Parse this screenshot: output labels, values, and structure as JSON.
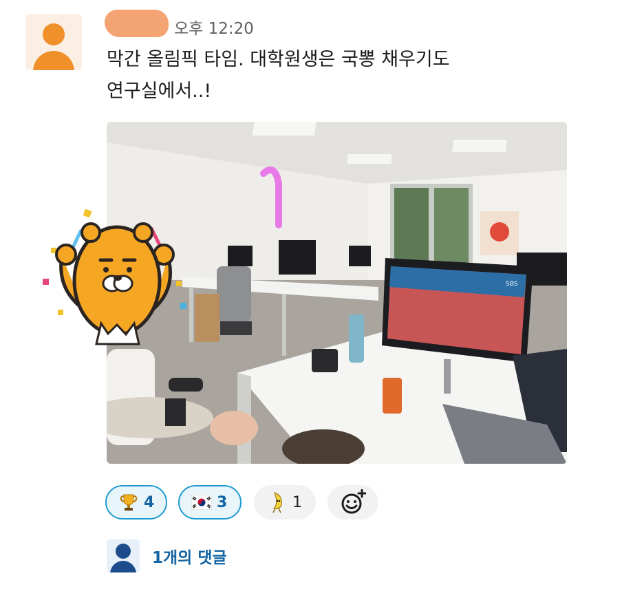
{
  "post": {
    "timestamp": "오후 12:20",
    "message_line1": "막간 올림픽 타임. 대학원생은 국뽕 채우기도",
    "message_line2": "연구실에서..!",
    "photo_tv_logo": "SBS"
  },
  "reactions": [
    {
      "emoji": "trophy-icon",
      "count": "4",
      "active": true
    },
    {
      "emoji": "korea-flag-icon",
      "count": "3",
      "active": true
    },
    {
      "emoji": "dancing-banana-icon",
      "count": "1",
      "active": false
    }
  ],
  "thread": {
    "replies_label": "1개의 댓글"
  },
  "colors": {
    "accent_blue": "#1264a3",
    "reaction_active_border": "#1d9bd1",
    "avatar_orange": "#f0902a"
  }
}
